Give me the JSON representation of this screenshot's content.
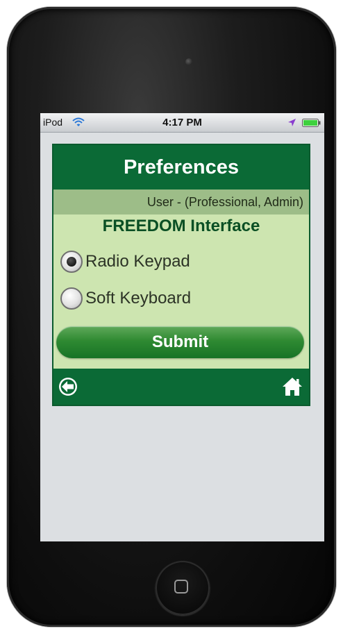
{
  "status_bar": {
    "carrier": "iPod",
    "time": "4:17 PM",
    "icons": [
      "wifi-icon",
      "location-icon",
      "battery-icon"
    ],
    "battery_color": "#3ed13e"
  },
  "app": {
    "title": "Preferences",
    "user_info": "User - (Professional, Admin)",
    "section_title": "FREEDOM Interface",
    "options": [
      {
        "label": "Radio Keypad",
        "selected": true
      },
      {
        "label": "Soft Keyboard",
        "selected": false
      }
    ],
    "submit_label": "Submit",
    "footer_icons": [
      "back-arrow-icon",
      "home-icon"
    ],
    "colors": {
      "header": "#0b6a36",
      "panel": "#cde5b0",
      "user_bar": "#9dbd88",
      "title_text": "#0a4f24"
    }
  }
}
